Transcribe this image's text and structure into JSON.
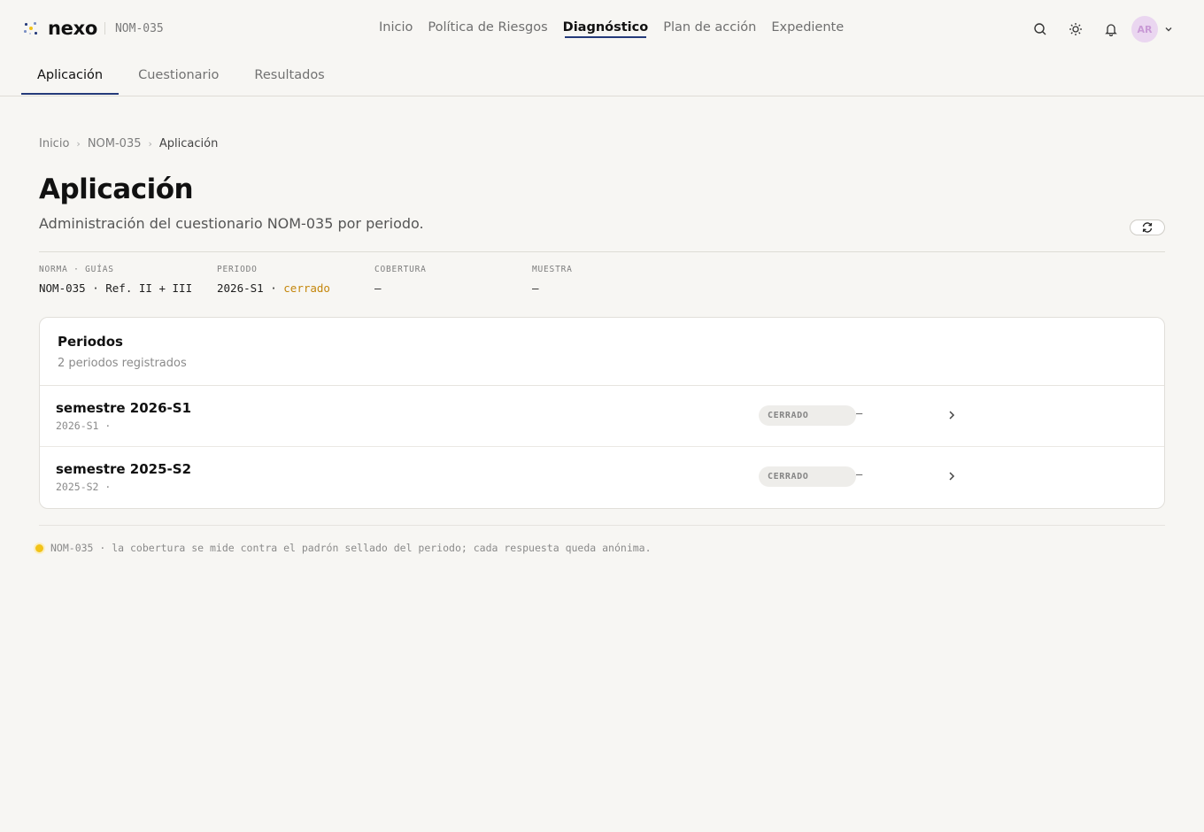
{
  "brand": {
    "name": "nexo",
    "context": "NOM-035"
  },
  "nav": {
    "items": [
      {
        "label": "Inicio"
      },
      {
        "label": "Política de Riesgos"
      },
      {
        "label": "Diagnóstico"
      },
      {
        "label": "Plan de acción"
      },
      {
        "label": "Expediente"
      }
    ],
    "active": "Diagnóstico"
  },
  "user": {
    "initials": "AR"
  },
  "tabs": [
    {
      "label": "Aplicación"
    },
    {
      "label": "Cuestionario"
    },
    {
      "label": "Resultados"
    }
  ],
  "breadcrumb": {
    "items": [
      "Inicio",
      "NOM-035",
      "Aplicación"
    ]
  },
  "page": {
    "title": "Aplicación",
    "description": "Administración del cuestionario NOM-035 por periodo."
  },
  "stats": [
    {
      "label": "NORMA · GUÍAS",
      "value": "NOM-035 · Ref. II + III"
    },
    {
      "label": "PERIODO",
      "value": "2026-S1 · ",
      "status": "cerrado"
    },
    {
      "label": "COBERTURA",
      "value": "—"
    },
    {
      "label": "MUESTRA",
      "value": "—"
    }
  ],
  "periods": {
    "title": "Periodos",
    "subtitle": "2 periodos registrados",
    "rows": [
      {
        "name": "semestre 2026-S1",
        "meta": "2026-S1 ·",
        "status": "CERRADO",
        "coverage": "—"
      },
      {
        "name": "semestre 2025-S2",
        "meta": "2025-S2 ·",
        "status": "CERRADO",
        "coverage": "—"
      }
    ]
  },
  "footnote": "NOM-035 · la cobertura se mide contra el padrón sellado del periodo; cada respuesta queda anónima.",
  "colors": {
    "accent": "#243a7a",
    "warning": "#c4860b",
    "indicator": "#f2c318"
  },
  "icons": [
    "search-icon",
    "sun-icon",
    "bell-icon",
    "chevron-down-icon",
    "refresh-icon",
    "chevron-right-icon"
  ]
}
